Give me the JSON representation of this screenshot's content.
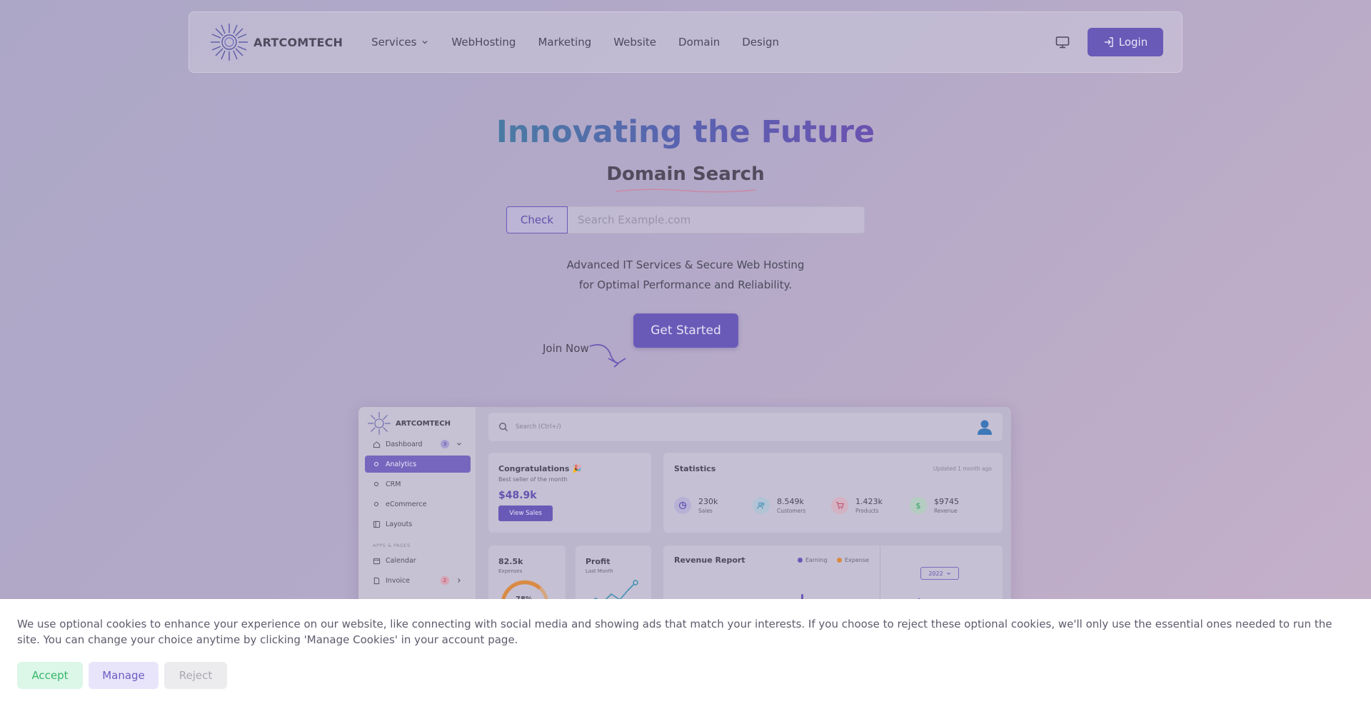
{
  "navbar": {
    "brand": "ARTCOMTECH",
    "links": [
      {
        "label": "Services",
        "has_dropdown": true
      },
      {
        "label": "WebHosting"
      },
      {
        "label": "Marketing"
      },
      {
        "label": "Website"
      },
      {
        "label": "Domain"
      },
      {
        "label": "Design"
      }
    ],
    "theme_icon": "monitor-icon",
    "login_label": "Login"
  },
  "hero": {
    "title": "Innovating the Future",
    "subtitle": "Domain Search",
    "check_label": "Check",
    "search_placeholder": "Search Example.com",
    "description_line1": "Advanced IT Services & Secure Web Hosting",
    "description_line2": "for Optimal Performance and Reliability.",
    "cta_label": "Get Started",
    "join_label": "Join Now"
  },
  "mockup": {
    "brand": "ARTCOMTECH",
    "search_placeholder": "Search (Ctrl+/)",
    "sidebar": {
      "dashboard": {
        "label": "Dashboard",
        "badge": "3"
      },
      "analytics": "Analytics",
      "crm": "CRM",
      "ecommerce": "eCommerce",
      "layouts": "Layouts",
      "section": "APPS & PAGES",
      "calendar": "Calendar",
      "invoice": {
        "label": "Invoice",
        "badge": "2"
      }
    },
    "congrats": {
      "title": "Congratulations 🎉",
      "subtitle": "Best seller of the month",
      "amount": "$48.9k",
      "button": "View Sales"
    },
    "statistics": {
      "title": "Statistics",
      "updated": "Updated 1 month ago",
      "items": [
        {
          "value": "230k",
          "label": "Sales"
        },
        {
          "value": "8.549k",
          "label": "Customers"
        },
        {
          "value": "1.423k",
          "label": "Products"
        },
        {
          "value": "$9745",
          "label": "Revenue"
        }
      ]
    },
    "expenses": {
      "value": "82.5k",
      "label": "Expenses",
      "percent": "78%"
    },
    "profit": {
      "title": "Profit",
      "subtitle": "Last Month"
    },
    "revenue": {
      "title": "Revenue Report",
      "legend_earning": "Earning",
      "legend_expense": "Expense",
      "year": "2022"
    }
  },
  "cookie": {
    "text": "We use optional cookies to enhance your experience on our website, like connecting with social media and showing ads that match your interests. If you choose to reject these optional cookies, we'll only use the essential ones needed to run the site. You can change your choice anytime by clicking 'Manage Cookies' in your account page.",
    "accept": "Accept",
    "manage": "Manage",
    "reject": "Reject"
  },
  "colors": {
    "primary": "#6a5ab7",
    "accept_text": "#33b768",
    "overlay_bg": "#b3a9c8"
  }
}
